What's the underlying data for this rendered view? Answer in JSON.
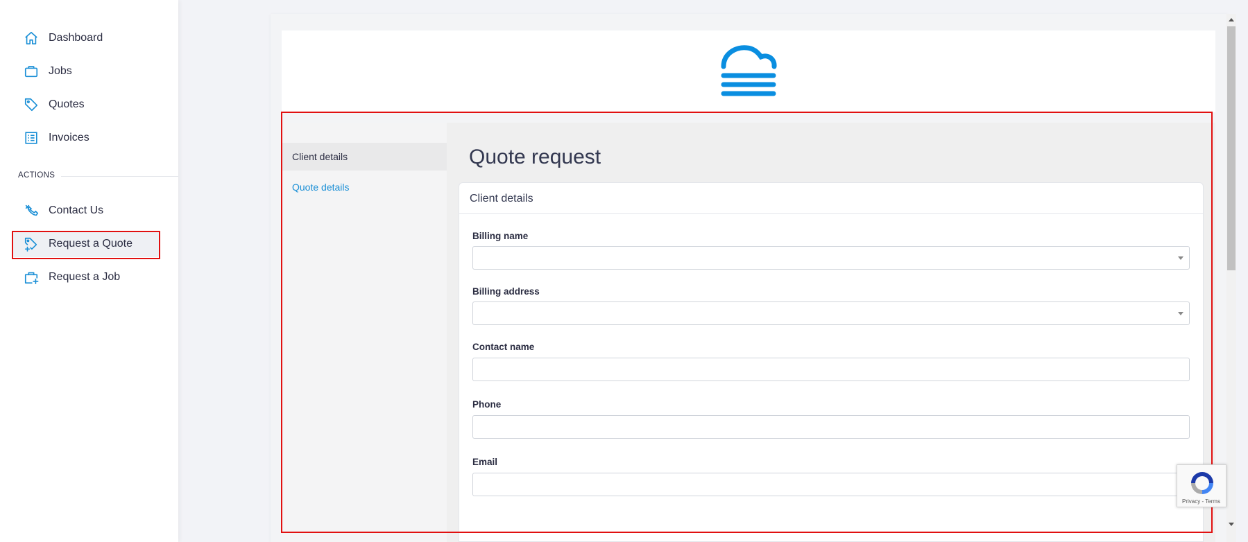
{
  "sidebar": {
    "items": [
      {
        "label": "Dashboard",
        "icon": "home-icon"
      },
      {
        "label": "Jobs",
        "icon": "briefcase-icon"
      },
      {
        "label": "Quotes",
        "icon": "tag-icon"
      },
      {
        "label": "Invoices",
        "icon": "list-icon"
      }
    ],
    "section_label": "ACTIONS",
    "actions": [
      {
        "label": "Contact Us",
        "icon": "contact-icon"
      },
      {
        "label": "Request a Quote",
        "icon": "tag-plus-icon"
      },
      {
        "label": "Request a Job",
        "icon": "briefcase-plus-icon"
      }
    ]
  },
  "steps": {
    "client_details": "Client details",
    "quote_details": "Quote details"
  },
  "main": {
    "title": "Quote request",
    "section_heading": "Client details",
    "fields": {
      "billing_name": {
        "label": "Billing name",
        "value": ""
      },
      "billing_address": {
        "label": "Billing address",
        "value": ""
      },
      "contact_name": {
        "label": "Contact name",
        "value": ""
      },
      "phone": {
        "label": "Phone",
        "value": ""
      },
      "email": {
        "label": "Email",
        "value": ""
      }
    }
  },
  "recaptcha": {
    "text": "Privacy - Terms"
  },
  "colors": {
    "accent": "#1a8fd6",
    "highlight": "#e11010",
    "logo": "#0a8ee0"
  }
}
